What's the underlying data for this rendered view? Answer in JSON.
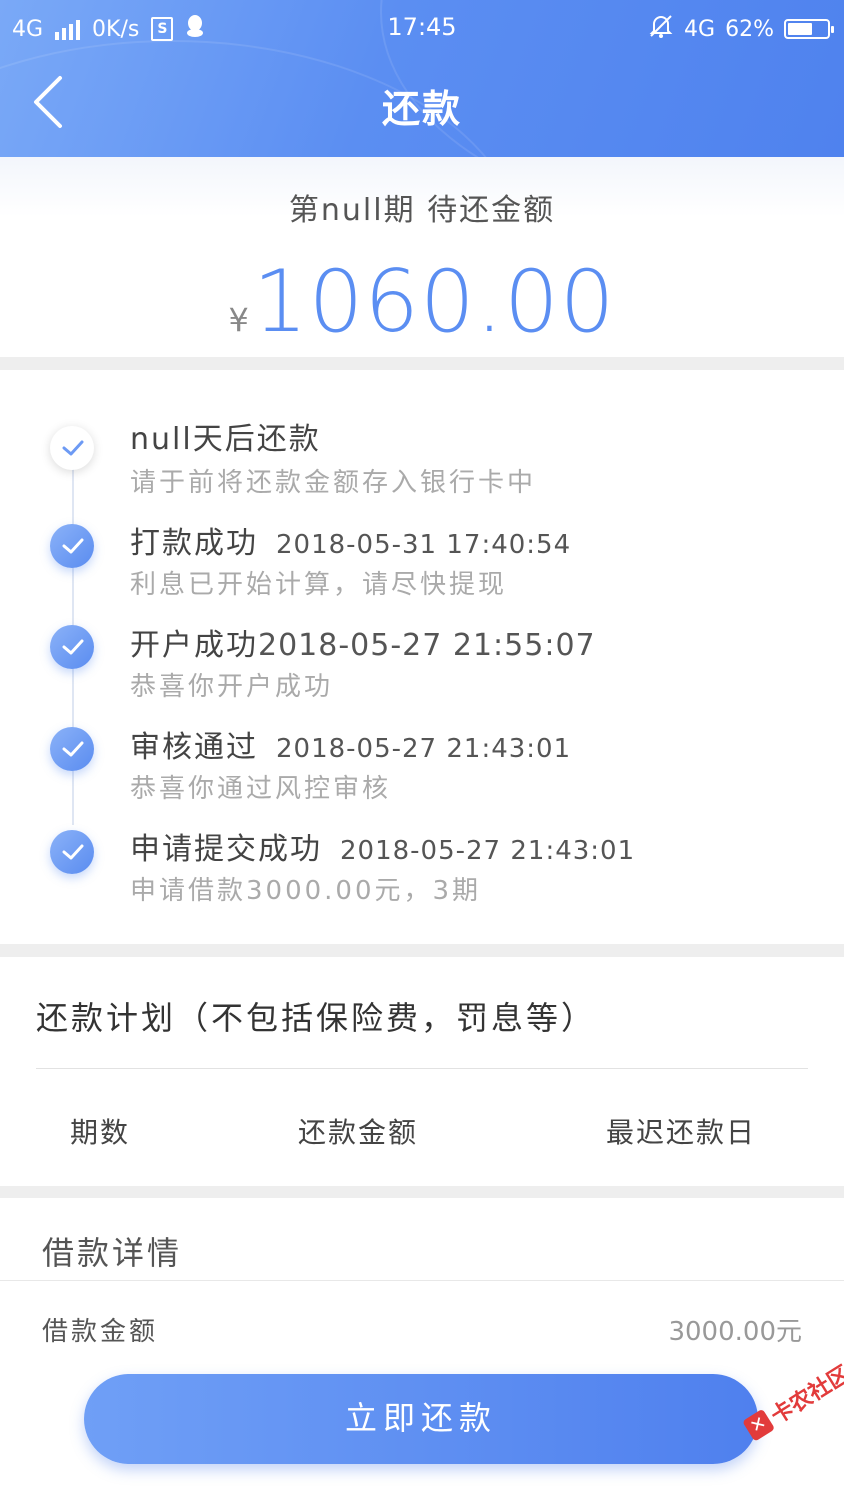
{
  "status_bar": {
    "network_left": "4G",
    "speed": "0K/s",
    "sim_badge": "S",
    "time": "17:45",
    "network_right": "4G",
    "battery": "62%",
    "battery_level": 0.62
  },
  "header": {
    "title": "还款"
  },
  "summary": {
    "period_label": "第null期 待还金额",
    "currency": "¥",
    "amount": "1060.00"
  },
  "timeline": [
    {
      "title": "null天后还款",
      "time": "",
      "subtitle": "请于前将还款金额存入银行卡中",
      "status": "pending"
    },
    {
      "title": "打款成功",
      "time": "2018-05-31 17:40:54",
      "subtitle": "利息已开始计算，请尽快提现",
      "status": "done"
    },
    {
      "title": "开户成功",
      "time": "2018-05-27 21:55:07",
      "subtitle": "恭喜你开户成功",
      "status": "done"
    },
    {
      "title": "审核通过",
      "time": "2018-05-27 21:43:01",
      "subtitle": "恭喜你通过风控审核",
      "status": "done"
    },
    {
      "title": "申请提交成功",
      "time": "2018-05-27 21:43:01",
      "subtitle": "申请借款3000.00元，3期",
      "status": "done"
    }
  ],
  "plan": {
    "title": "还款计划（不包括保险费，罚息等）",
    "columns": [
      "期数",
      "还款金额",
      "最迟还款日"
    ]
  },
  "detail": {
    "title": "借款详情",
    "rows": [
      {
        "label": "借款金额",
        "value": "3000.00元"
      }
    ]
  },
  "actions": {
    "pay_now": "立即还款"
  },
  "watermark": {
    "text": "卡农社区"
  },
  "colors": {
    "accent": "#5b8ef2",
    "header_start": "#7aa9f7",
    "header_end": "#4f82ee",
    "watermark": "#e23b3b"
  }
}
